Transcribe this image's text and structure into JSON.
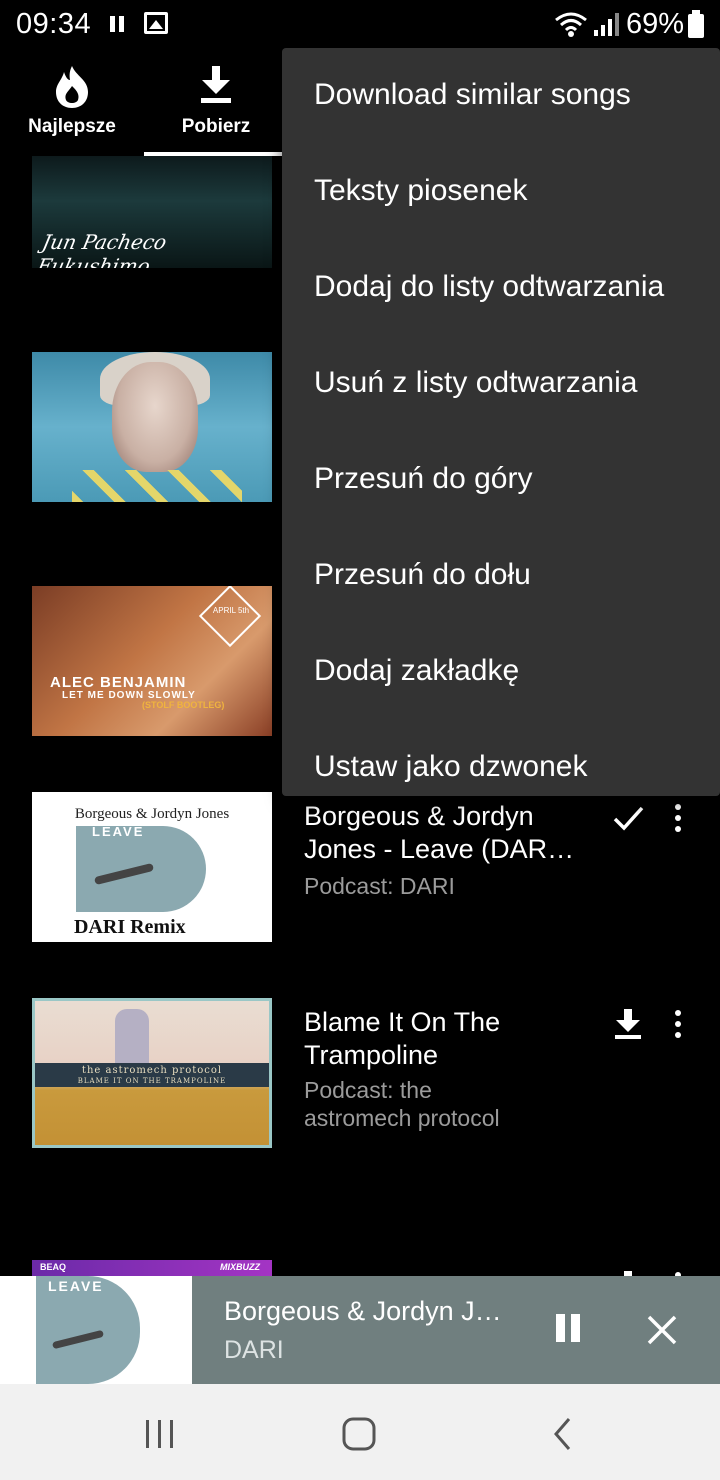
{
  "status_bar": {
    "time": "09:34",
    "battery": "69%",
    "icons": [
      "pause-icon",
      "image-icon",
      "wifi-icon",
      "signal-icon",
      "battery-icon"
    ]
  },
  "tabs": [
    {
      "label": "Najlepsze",
      "icon": "flame-icon",
      "selected": false
    },
    {
      "label": "Pobierz",
      "icon": "download-icon",
      "selected": true
    }
  ],
  "list": {
    "items": [
      {
        "title": "",
        "subtitle": "",
        "art_text": "Jun Pacheco Fukushimo",
        "action": ""
      },
      {
        "title": "",
        "subtitle": "",
        "art_text": "",
        "action": ""
      },
      {
        "title": "",
        "subtitle": "",
        "art_artist": "ALEC BENJAMIN",
        "art_song": "LET ME DOWN SLOWLY",
        "art_extra": "(STOLF BOOTLEG)",
        "art_badge": "APRIL 5th",
        "action": ""
      },
      {
        "title": "Borgeous & Jordyn Jones - Leave (DAR…",
        "subtitle": "Podcast: DARI",
        "art_top": "Borgeous & Jordyn Jones",
        "art_mid": "LEAVE",
        "art_bottom": "DARI Remix",
        "action": "check-icon"
      },
      {
        "title": "Blame It On The Trampoline",
        "subtitle": "Podcast: the astromech protocol",
        "art_line1": "the astromech protocol",
        "art_line2": "BLAME IT ON THE TRAMPOLINE",
        "action": "download-icon"
      },
      {
        "title": "",
        "subtitle": "",
        "art_left": "BEAQ",
        "art_right": "MIXBUZZ",
        "action": "download-icon"
      }
    ]
  },
  "menu": {
    "items": [
      "Download similar songs",
      "Teksty piosenek",
      "Dodaj do listy odtwarzania",
      "Usuń z listy odtwarzania",
      "Przesuń do góry",
      "Przesuń do dołu",
      "Dodaj zakładkę",
      "Ustaw jako dzwonek"
    ]
  },
  "player": {
    "title": "Borgeous & Jordyn J…",
    "subtitle": "DARI",
    "art_text": "LEAVE"
  },
  "nav": {
    "buttons": [
      "recents-icon",
      "home-icon",
      "back-icon"
    ]
  },
  "colors": {
    "background": "#000000",
    "menu_bg": "#333333",
    "player_bg": "#707f7f",
    "navbar_bg": "#f1f1f1",
    "secondary_text": "#9b9b9b"
  }
}
